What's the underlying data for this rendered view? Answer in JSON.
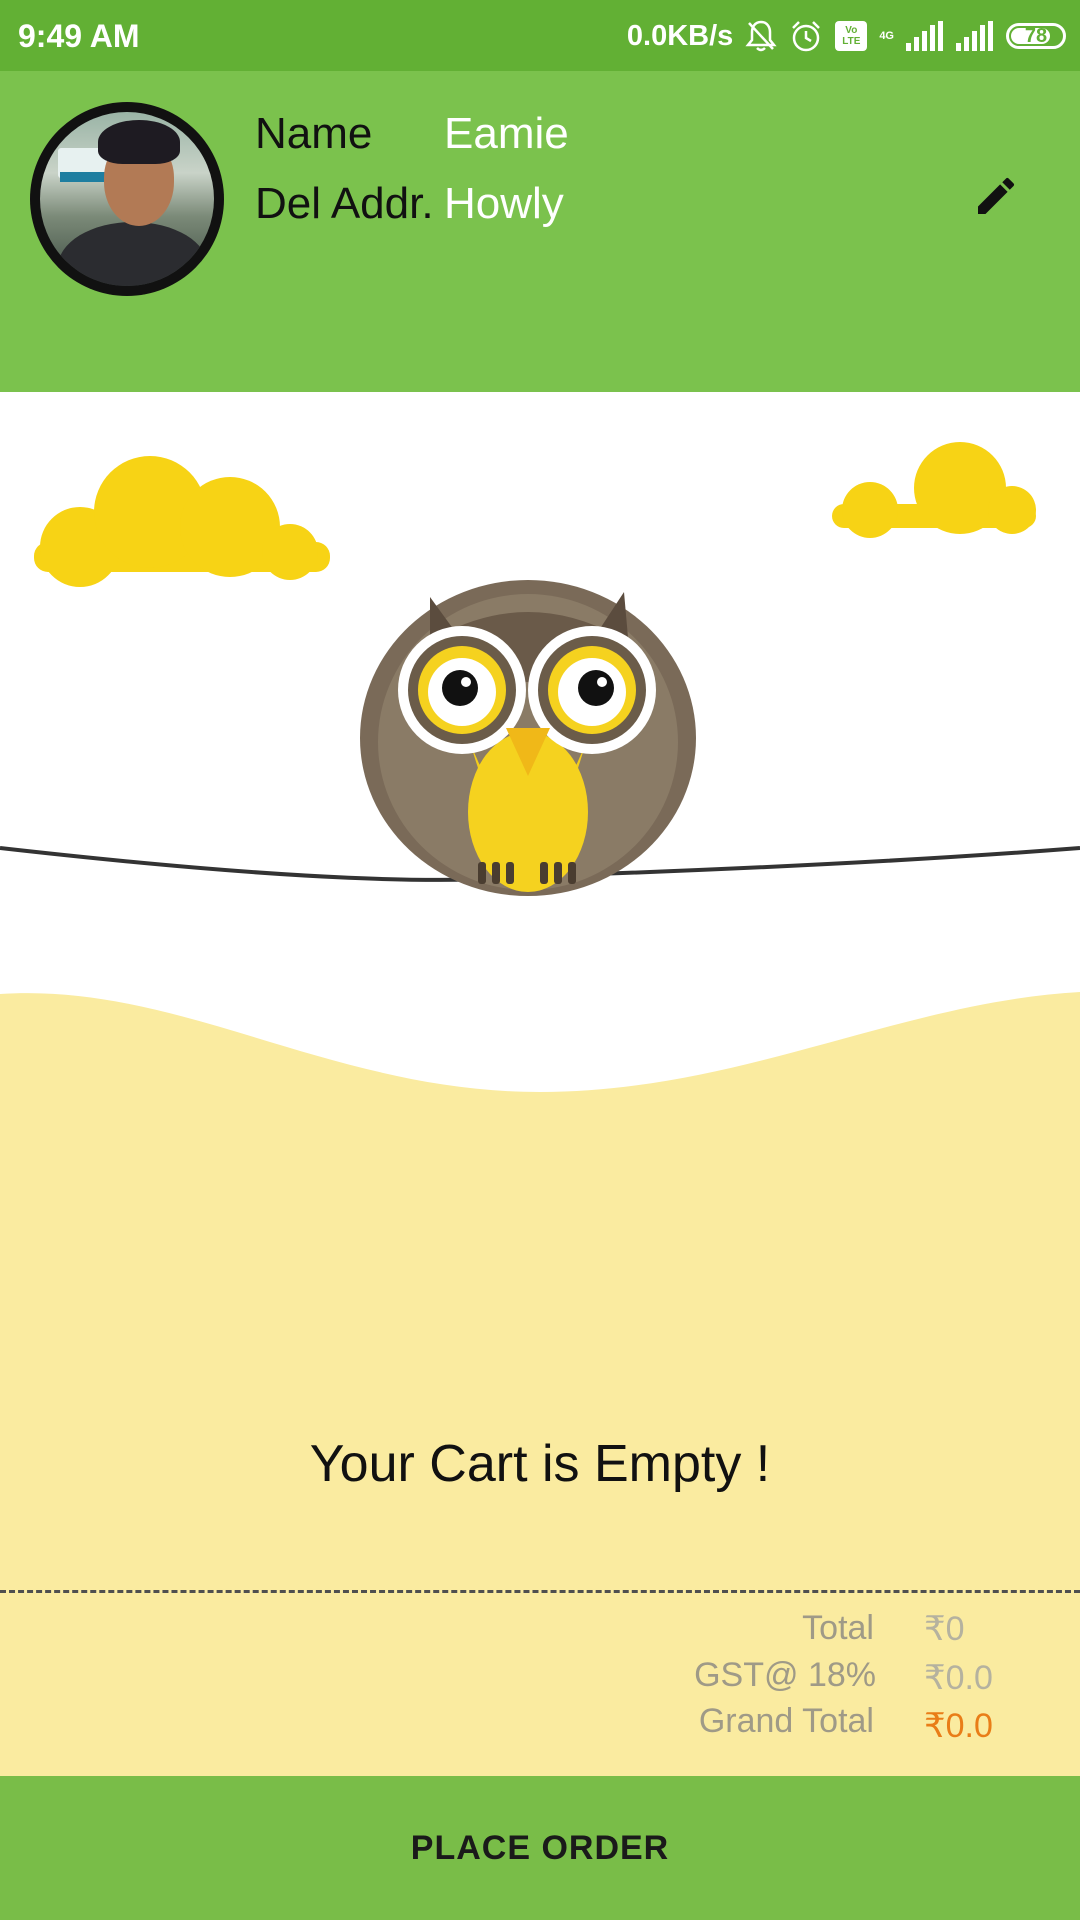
{
  "status_bar": {
    "time": "9:49 AM",
    "speed": "0.0KB/s",
    "volte_line1": "Vo",
    "volte_line2": "LTE",
    "net_gen": "4G",
    "battery": "78",
    "battery_level": 0.78,
    "icons": [
      "bell-off-icon",
      "alarm-icon",
      "volte-icon",
      "signal-icon",
      "signal-icon",
      "battery-icon"
    ]
  },
  "profile": {
    "name_label": "Name",
    "name_value": "Eamie",
    "address_label": "Del Addr.",
    "address_value": "Howly",
    "edit_icon": "pencil-icon"
  },
  "cart": {
    "empty_message": "Your Cart is Empty !",
    "illustration": "owl-on-wire-illustration"
  },
  "summary": {
    "total_label": "Total",
    "total_value": "₹0",
    "gst_label": "GST@ 18%",
    "gst_value": "₹0.0",
    "grand_total_label": "Grand Total",
    "grand_total_value": "₹0.0"
  },
  "actions": {
    "place_order_label": "PLACE ORDER"
  },
  "colors": {
    "status_bar": "#62b034",
    "header": "#7bc24d",
    "background": "#faeba0",
    "button": "#79bd48",
    "grand_total": "#e97d17"
  }
}
